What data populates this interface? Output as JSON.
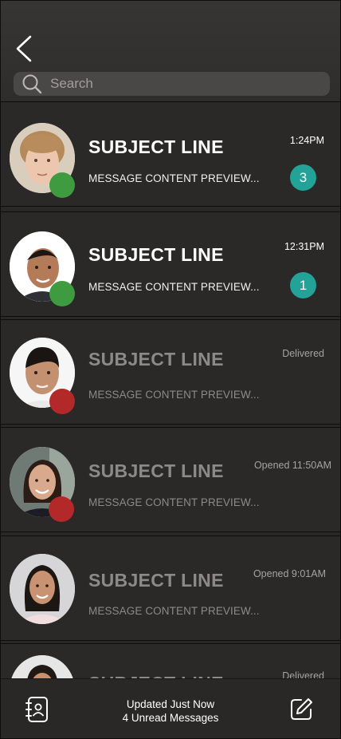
{
  "search": {
    "placeholder": "Search"
  },
  "conversations": [
    {
      "subject": "SUBJECT LINE",
      "preview": "MESSAGE CONTENT PREVIEW...",
      "time": "1:24PM",
      "unread_count": "3",
      "status": "online"
    },
    {
      "subject": "SUBJECT LINE",
      "preview": "MESSAGE CONTENT PREVIEW...",
      "time": "12:31PM",
      "unread_count": "1",
      "status": "online"
    },
    {
      "subject": "SUBJECT LINE",
      "preview": "MESSAGE CONTENT PREVIEW...",
      "time": "Delivered",
      "status": "offline"
    },
    {
      "subject": "SUBJECT LINE",
      "preview": "MESSAGE CONTENT PREVIEW...",
      "time": "Opened 11:50AM",
      "status": "offline"
    },
    {
      "subject": "SUBJECT LINE",
      "preview": "MESSAGE CONTENT PREVIEW...",
      "time": "Opened 9:01AM"
    },
    {
      "subject": "SUBJECT LINE",
      "time": "Delivered"
    }
  ],
  "footer": {
    "status_line1": "Updated Just Now",
    "status_line2": "4 Unread Messages"
  },
  "colors": {
    "online": "#3e9b3f",
    "offline": "#b32929",
    "badge": "#23a398"
  }
}
